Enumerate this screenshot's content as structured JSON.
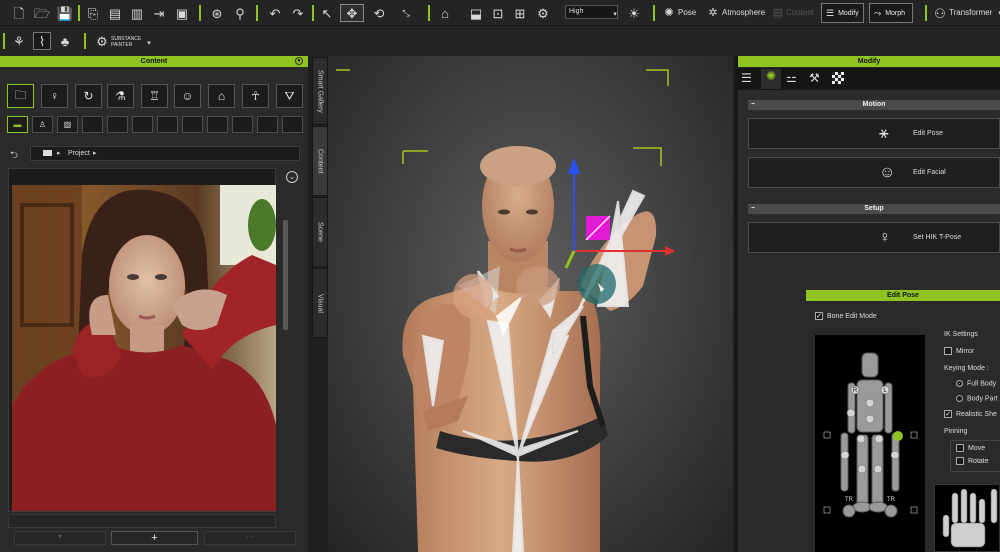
{
  "toolbar": {
    "quality_value": "High",
    "pose_label": "Pose",
    "atmosphere_label": "Atmosphere",
    "content_label": "Content",
    "modify_label": "Modify",
    "morph_label": "Morph",
    "transformer_label": "Transformer",
    "substance_line1": "SUBSTANCE",
    "substance_line2": "PAINTER"
  },
  "content_panel": {
    "title": "Content",
    "path_root": "Project",
    "add_glyph": "+",
    "side_tabs": [
      "Smart Gallery",
      "Content",
      "Scene",
      "Visual"
    ]
  },
  "modify_panel": {
    "title": "Modify",
    "motion_section": "Motion",
    "edit_pose": "Edit Pose",
    "edit_facial": "Edit Facial",
    "setup_section": "Setup",
    "set_hik": "Set HIK T-Pose"
  },
  "edit_pose_panel": {
    "title": "Edit Pose",
    "bone_edit_mode": "Bone Edit Mode",
    "ik_settings": "IK Settings",
    "mirror": "Mirror",
    "keying_mode": "Keying Mode :",
    "full_body": "Full Body",
    "body_part": "Body Part",
    "realistic": "Realistic She",
    "pinning": "Pinning",
    "move": "Move",
    "rotate": "Rotate",
    "figure_marks": {
      "l": "L",
      "r": "R",
      "t": "T",
      "tr": "TR"
    }
  },
  "colors": {
    "accent": "#8fc31f",
    "gizmo_magenta": "#e11ad6",
    "gizmo_blue": "#2b4fff",
    "gizmo_red": "#e23131"
  }
}
